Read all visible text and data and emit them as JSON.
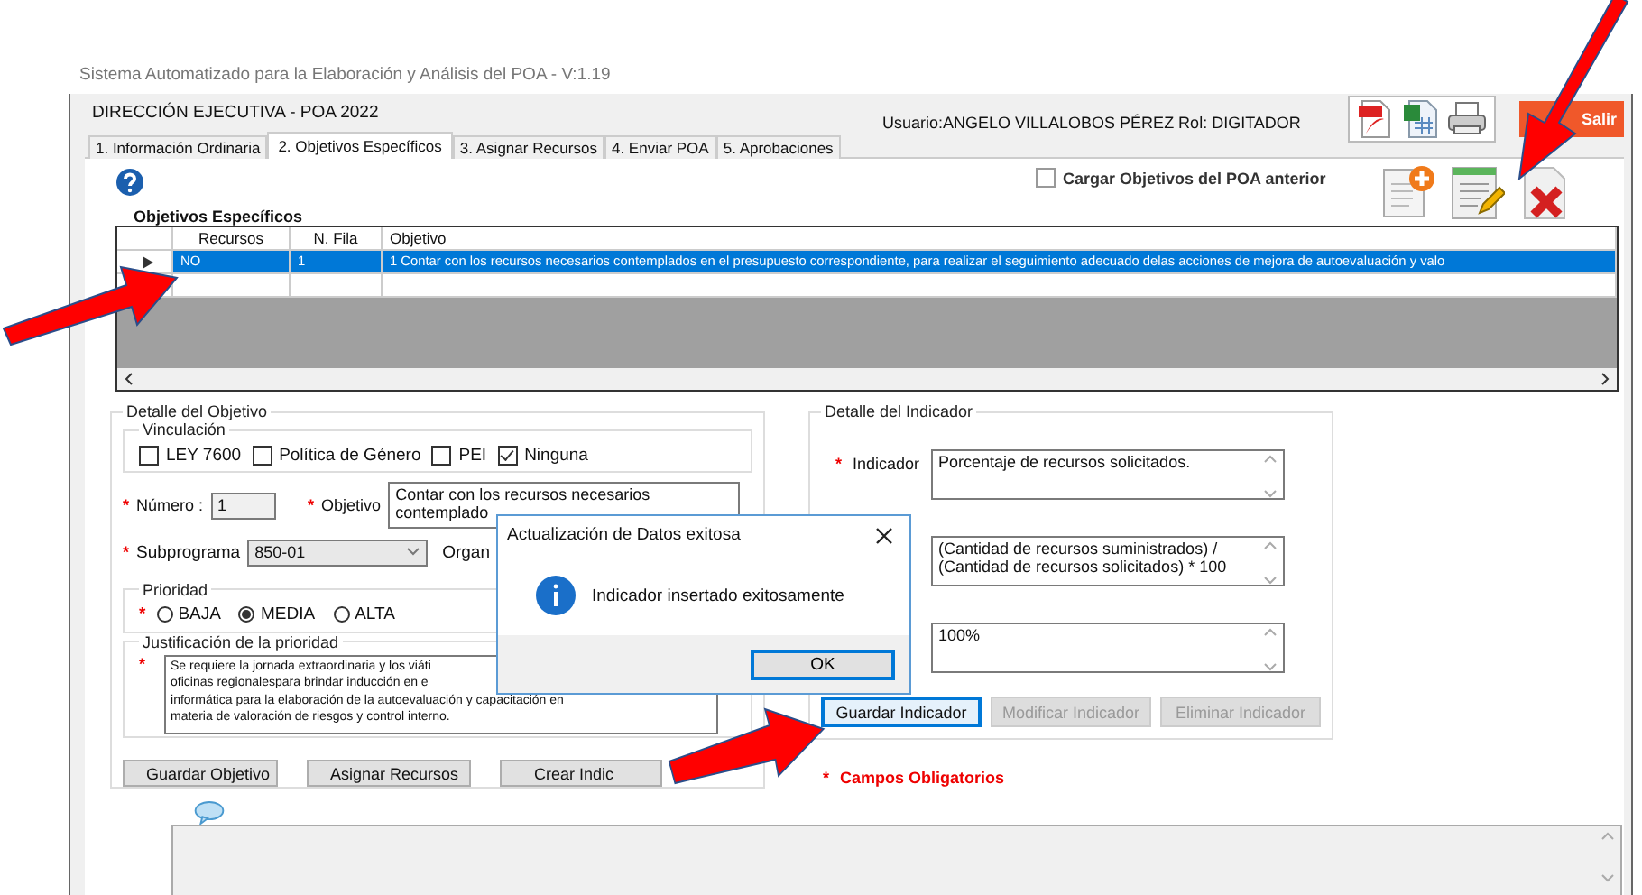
{
  "app_title": "Sistema Automatizado para la Elaboración y Análisis del POA -  V:1.19",
  "header": {
    "title": "DIRECCIÓN EJECUTIVA - POA 2022",
    "user": "Usuario:ANGELO VILLALOBOS PÉREZ  Rol: DIGITADOR",
    "exit_button": "Salir"
  },
  "tabs": [
    {
      "label": "1. Información Ordinaria",
      "selected": false
    },
    {
      "label": "2. Objetivos Específicos",
      "selected": true
    },
    {
      "label": "3. Asignar Recursos",
      "selected": false
    },
    {
      "label": "4. Enviar POA",
      "selected": false
    },
    {
      "label": "5. Aprobaciones",
      "selected": false
    }
  ],
  "load_previous": {
    "label": "Cargar Objetivos del POA anterior",
    "checked": false
  },
  "objectives": {
    "title": "Objetivos Específicos",
    "columns": [
      "Recursos",
      "N. Fila",
      "Objetivo"
    ],
    "rows": [
      {
        "cells": [
          "NO",
          "1",
          "1 Contar con los recursos necesarios contemplados en el presupuesto correspondiente, para realizar el seguimiento adecuado delas acciones de mejora de autoevaluación y valo"
        ],
        "selected": true
      }
    ]
  },
  "objective_detail": {
    "title": "Detalle del Objetivo",
    "linkage": {
      "title": "Vinculación",
      "options": [
        {
          "label": "LEY 7600",
          "checked": false
        },
        {
          "label": "Política de Género",
          "checked": false
        },
        {
          "label": "PEI",
          "checked": false
        },
        {
          "label": "Ninguna",
          "checked": true
        }
      ]
    },
    "number": {
      "mark": "*",
      "label": "Número :",
      "value": "1"
    },
    "objective": {
      "mark": "*",
      "label": "Objetivo",
      "value": "Contar con los recursos necesarios\ncontemplado"
    },
    "subprogram": {
      "mark": "*",
      "label": "Subprograma",
      "value": "850-01"
    },
    "organ_label": "Organ",
    "priority": {
      "title": "Prioridad",
      "mark": "*",
      "options": [
        {
          "label": "BAJA",
          "selected": false
        },
        {
          "label": "MEDIA",
          "selected": true
        },
        {
          "label": "ALTA",
          "selected": false
        }
      ]
    },
    "justification": {
      "title": "Justificación de la prioridad",
      "mark": "*",
      "value": "Se requiere la jornada extraordinaria y los viáti\noficinas regionalespara brindar inducción en e\ninformática para la elaboración de la autoevaluación y capacitación en\nmateria de valoración de riesgos y control interno."
    },
    "buttons": [
      "Guardar Objetivo",
      "Asignar Recursos",
      "Crear Indic"
    ]
  },
  "indicator_detail": {
    "title": "Detalle del Indicador",
    "fields": [
      {
        "mark": "*",
        "label": "Indicador",
        "value": "Porcentaje de recursos solicitados."
      },
      {
        "value": "(Cantidad de recursos suministrados) /\n(Cantidad de recursos solicitados) * 100"
      },
      {
        "value": "100%"
      }
    ],
    "buttons": [
      {
        "label": "Guardar Indicador",
        "disabled": false
      },
      {
        "label": "Modificar Indicador",
        "disabled": true
      },
      {
        "label": "Eliminar Indicador",
        "disabled": true
      }
    ]
  },
  "required_note": {
    "mark": "*",
    "text": "Campos Obligatorios"
  },
  "dialog": {
    "title": "Actualización de Datos exitosa",
    "message": "Indicador insertado exitosamente",
    "button": "OK"
  }
}
